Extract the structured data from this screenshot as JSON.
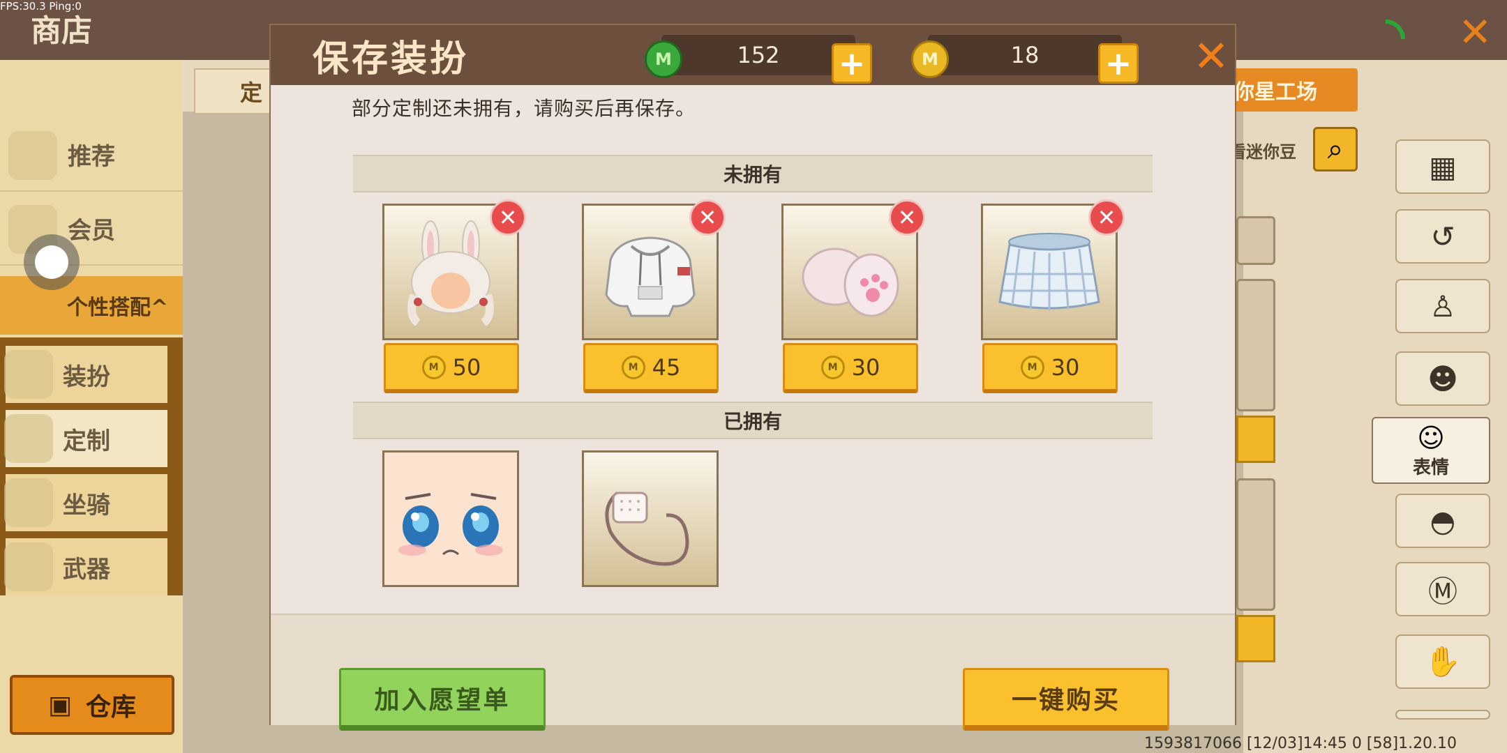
{
  "debug": {
    "fps_text": "FPS:30.3  Ping:0"
  },
  "shop": {
    "title": "商店",
    "sidebar": [
      {
        "label": "推荐",
        "icon": "thumbs-up-icon"
      },
      {
        "label": "会员",
        "icon": "member-icon"
      }
    ],
    "personal_section": "个性搭配^",
    "sub_items": [
      {
        "label": "装扮",
        "icon": "shirt-icon"
      },
      {
        "label": "定制",
        "icon": "pencil-icon",
        "active": true
      },
      {
        "label": "坐骑",
        "icon": "mount-icon"
      },
      {
        "label": "武器",
        "icon": "gun-icon"
      }
    ],
    "warehouse_label": "仓库",
    "tab_partial": "定",
    "workshop_label": "你星工场",
    "search_label": "看迷你豆",
    "expression_label": "表情",
    "footer_info": "1593817066   [12/03]14:45 0   [58]1.20.10"
  },
  "modal": {
    "title": "保存装扮",
    "currency": [
      {
        "name": "mini-bean",
        "amount": "152",
        "color": "#3aa83a"
      },
      {
        "name": "mini-coin",
        "amount": "18",
        "color": "#e9b824"
      }
    ],
    "notice": "部分定制还未拥有，请购买后再保存。",
    "not_owned_title": "未拥有",
    "owned_title": "已拥有",
    "not_owned_items": [
      {
        "name": "bunny-ear-hair",
        "price": "50"
      },
      {
        "name": "white-hoodie",
        "price": "45"
      },
      {
        "name": "paw-gloves",
        "price": "30"
      },
      {
        "name": "plaid-skirt",
        "price": "30"
      }
    ],
    "owned_items": [
      {
        "name": "shy-face"
      },
      {
        "name": "face-mask"
      }
    ],
    "wishlist_label": "加入愿望单",
    "buy_label": "一键购买"
  }
}
